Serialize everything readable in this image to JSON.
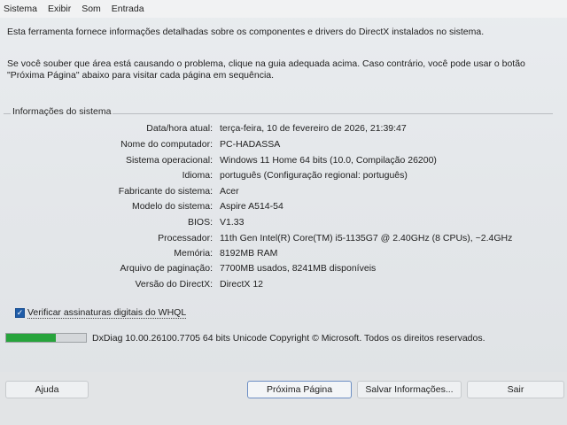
{
  "menu": [
    "Sistema",
    "Exibir",
    "Som",
    "Entrada"
  ],
  "intro": {
    "line1": "Esta ferramenta fornece informações detalhadas sobre os componentes e drivers do DirectX instalados no sistema.",
    "line2": "Se você souber que área está causando o problema, clique na guia adequada acima. Caso contrário, você pode usar o botão \"Próxima Página\" abaixo para visitar cada página em sequência."
  },
  "group": {
    "title": "Informações do sistema",
    "rows": [
      {
        "label": "Data/hora atual:",
        "value": "terça-feira, 10 de fevereiro de 2026, 21:39:47"
      },
      {
        "label": "Nome do computador:",
        "value": "PC-HADASSA"
      },
      {
        "label": "Sistema operacional:",
        "value": "Windows 11 Home 64 bits (10.0, Compilação 26200)"
      },
      {
        "label": "Idioma:",
        "value": "português (Configuração regional: português)"
      },
      {
        "label": "Fabricante do sistema:",
        "value": "Acer"
      },
      {
        "label": "Modelo do sistema:",
        "value": "Aspire A514-54"
      },
      {
        "label": "BIOS:",
        "value": "V1.33"
      },
      {
        "label": "Processador:",
        "value": "11th Gen Intel(R) Core(TM) i5-1135G7 @ 2.40GHz (8 CPUs), ~2.4GHz"
      },
      {
        "label": "Memória:",
        "value": "8192MB RAM"
      },
      {
        "label": "Arquivo de paginação:",
        "value": "7700MB usados, 8241MB disponíveis"
      },
      {
        "label": "Versão do DirectX:",
        "value": "DirectX 12"
      }
    ]
  },
  "whql": {
    "label": "Verificar assinaturas digitais do WHQL",
    "checked": true
  },
  "progress": {
    "fraction": 0.62,
    "color": "#27a43c"
  },
  "status": "DxDiag 10.00.26100.7705 64 bits Unicode  Copyright © Microsoft. Todos os direitos reservados.",
  "buttons": {
    "help": "Ajuda",
    "next": "Próxima Página",
    "save": "Salvar Informações...",
    "exit": "Sair"
  }
}
